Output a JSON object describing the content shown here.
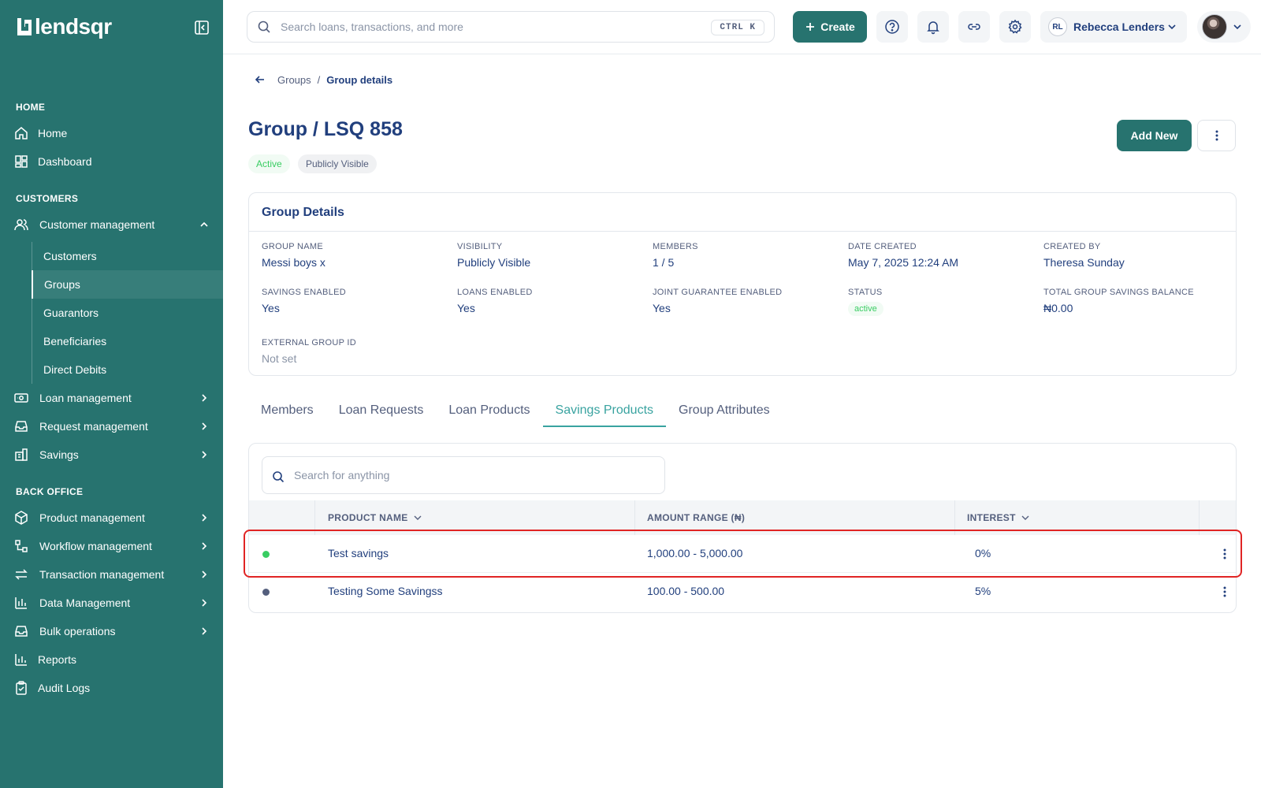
{
  "brand": {
    "name": "lendsqr"
  },
  "sidebar": {
    "sections": {
      "home": "HOME",
      "customers": "CUSTOMERS",
      "back_office": "BACK OFFICE"
    },
    "home_items": [
      {
        "label": "Home"
      },
      {
        "label": "Dashboard"
      }
    ],
    "customer_management": {
      "label": "Customer management",
      "children": [
        {
          "label": "Customers"
        },
        {
          "label": "Groups"
        },
        {
          "label": "Guarantors"
        },
        {
          "label": "Beneficiaries"
        },
        {
          "label": "Direct Debits"
        }
      ]
    },
    "customer_items": [
      {
        "label": "Loan management"
      },
      {
        "label": "Request management"
      },
      {
        "label": "Savings"
      }
    ],
    "back_office_items": [
      {
        "label": "Product management"
      },
      {
        "label": "Workflow management"
      },
      {
        "label": "Transaction management"
      },
      {
        "label": "Data Management"
      },
      {
        "label": "Bulk operations"
      },
      {
        "label": "Reports"
      },
      {
        "label": "Audit Logs"
      }
    ]
  },
  "topbar": {
    "search_placeholder": "Search loans, transactions, and more",
    "shortcut": "CTRL K",
    "create_label": "Create",
    "user": {
      "initials": "RL",
      "name": "Rebecca Lenders"
    }
  },
  "breadcrumb": {
    "parent": "Groups",
    "separator": "/",
    "current": "Group details"
  },
  "page": {
    "title": "Group / LSQ 858",
    "badges": {
      "status": "Active",
      "visibility": "Publicly Visible"
    },
    "add_new_label": "Add New"
  },
  "details": {
    "title": "Group Details",
    "fields": {
      "group_name": {
        "label": "GROUP NAME",
        "value": "Messi boys x"
      },
      "visibility": {
        "label": "VISIBILITY",
        "value": "Publicly Visible"
      },
      "members": {
        "label": "MEMBERS",
        "value": "1 / 5"
      },
      "date_created": {
        "label": "DATE CREATED",
        "value": "May 7, 2025 12:24 AM"
      },
      "created_by": {
        "label": "CREATED BY",
        "value": "Theresa Sunday"
      },
      "savings_enabled": {
        "label": "SAVINGS ENABLED",
        "value": "Yes"
      },
      "loans_enabled": {
        "label": "LOANS ENABLED",
        "value": "Yes"
      },
      "joint_guarantee": {
        "label": "JOINT GUARANTEE ENABLED",
        "value": "Yes"
      },
      "status": {
        "label": "STATUS",
        "value": "active"
      },
      "total_savings": {
        "label": "TOTAL GROUP SAVINGS BALANCE",
        "value": "₦0.00"
      },
      "external_id": {
        "label": "EXTERNAL GROUP ID",
        "value": "Not set"
      }
    }
  },
  "tabs": [
    {
      "label": "Members"
    },
    {
      "label": "Loan Requests"
    },
    {
      "label": "Loan Products"
    },
    {
      "label": "Savings Products",
      "active": true
    },
    {
      "label": "Group Attributes"
    }
  ],
  "savings_table": {
    "search_placeholder": "Search for anything",
    "columns": {
      "name": "PRODUCT NAME",
      "amount": "AMOUNT RANGE (₦)",
      "interest": "INTEREST"
    },
    "rows": [
      {
        "name": "Test savings",
        "amount": "1,000.00 - 5,000.00",
        "interest": "0%",
        "status_color": "#39cd62"
      },
      {
        "name": "Testing Some Savingss",
        "amount": "100.00 - 500.00",
        "interest": "5%",
        "status_color": "#545f7d"
      }
    ]
  },
  "colors": {
    "accent": "#27736f",
    "tab_active": "#39a3a0",
    "highlight": "#e02424"
  }
}
